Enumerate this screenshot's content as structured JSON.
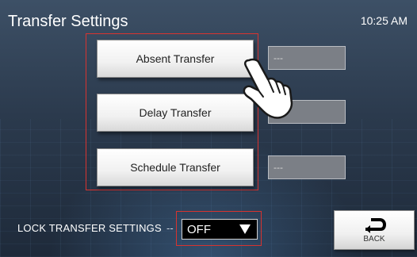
{
  "header": {
    "title": "Transfer Settings",
    "time": "10:25 AM"
  },
  "transfers": [
    {
      "label": "Absent Transfer",
      "value": "---"
    },
    {
      "label": "Delay Transfer",
      "value": "---"
    },
    {
      "label": "Schedule Transfer",
      "value": "---"
    }
  ],
  "lock": {
    "label": "LOCK TRANSFER SETTINGS",
    "separator": "--",
    "selected": "OFF"
  },
  "back": {
    "label": "BACK",
    "icon": "back-arrow-icon"
  },
  "pointer": {
    "icon": "hand-pointer-icon"
  },
  "colors": {
    "highlight": "#d8332f",
    "background": "#2f3f53"
  }
}
